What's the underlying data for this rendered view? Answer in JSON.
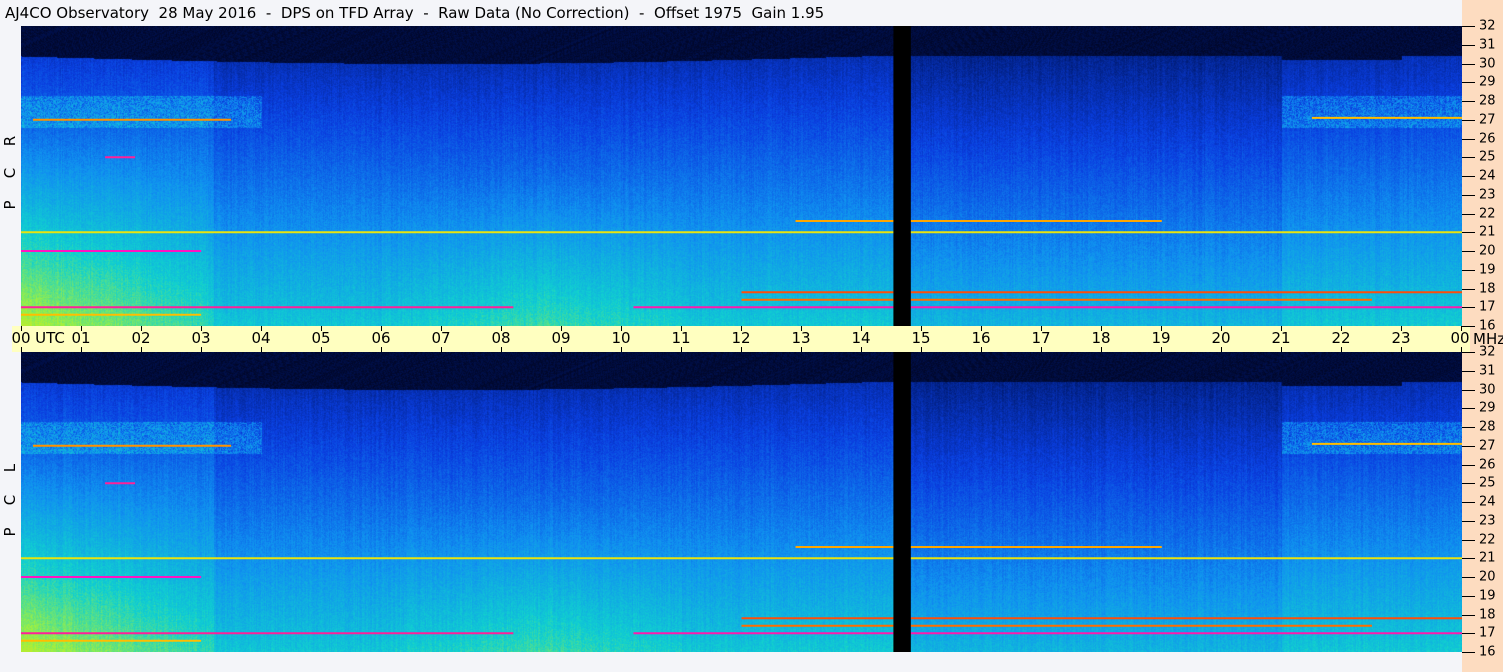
{
  "title": "AJ4CO Observatory  28 May 2016  -  DPS on TFD Array  -  Raw Data (No Correction)  -  Offset 1975  Gain 1.95",
  "chart_data": {
    "type": "heatmap",
    "title": "AJ4CO Observatory 28 May 2016 - DPS on TFD Array - Raw Data (No Correction) - Offset 1975 Gain 1.95",
    "xlabel": "UTC",
    "ylabel": "MHz",
    "xlim": [
      0,
      24
    ],
    "ylim": [
      16,
      32
    ],
    "x_ticks": [
      "00",
      "01",
      "02",
      "03",
      "04",
      "05",
      "06",
      "07",
      "08",
      "09",
      "10",
      "11",
      "12",
      "13",
      "14",
      "15",
      "16",
      "17",
      "18",
      "19",
      "20",
      "21",
      "22",
      "23",
      "00"
    ],
    "x_unit": "UTC",
    "y_unit": "MHz",
    "y_ticks": [
      "32",
      "31",
      "30",
      "29",
      "28",
      "27",
      "26",
      "25",
      "24",
      "23",
      "22",
      "21",
      "20",
      "19",
      "18",
      "17",
      "16"
    ],
    "panels": [
      {
        "name": "RCP",
        "label": "R C P"
      },
      {
        "name": "LCP",
        "label": "L C P"
      }
    ],
    "data_gap_utc": [
      14.53,
      14.82
    ],
    "colormap": [
      "#000010",
      "#001a70",
      "#0a3ee0",
      "#1090f0",
      "#10d0d0",
      "#a0f040",
      "#ffe000",
      "#ff5000",
      "#ff00ff"
    ],
    "interference": [
      {
        "freq": 27.0,
        "start": 0.2,
        "end": 3.5,
        "level": 0.82
      },
      {
        "freq": 27.1,
        "start": 21.5,
        "end": 24,
        "level": 0.78
      },
      {
        "freq": 25.0,
        "start": 1.4,
        "end": 1.9,
        "level": 0.95
      },
      {
        "freq": 21.0,
        "start": 0,
        "end": 24,
        "level": 0.72
      },
      {
        "freq": 20.0,
        "start": 0,
        "end": 3.0,
        "level": 0.97
      },
      {
        "freq": 21.6,
        "start": 12.9,
        "end": 19.0,
        "level": 0.8
      },
      {
        "freq": 17.8,
        "start": 12.0,
        "end": 24,
        "level": 0.88
      },
      {
        "freq": 17.0,
        "start": 0,
        "end": 8.2,
        "level": 0.95
      },
      {
        "freq": 17.0,
        "start": 10.2,
        "end": 24,
        "level": 0.96
      },
      {
        "freq": 17.4,
        "start": 12.0,
        "end": 22.5,
        "level": 0.85
      },
      {
        "freq": 16.6,
        "start": 0,
        "end": 3.0,
        "level": 0.78
      }
    ]
  }
}
